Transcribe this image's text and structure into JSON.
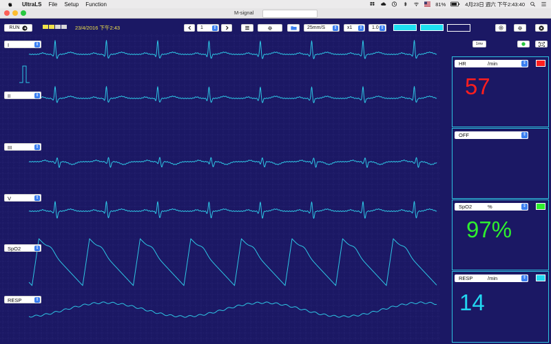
{
  "menubar": {
    "app_name": "UltraLS",
    "menus": [
      "File",
      "Setup",
      "Function"
    ],
    "battery": "81%",
    "datetime": "4月23日 週六 下午2:43:40"
  },
  "window": {
    "title": "M-signal"
  },
  "toolbar": {
    "run_label": "RUN",
    "date_time": "23/4/2016 下午2:43",
    "page_value": "1",
    "speed": "25mm/S",
    "gain": "x1",
    "scale": "1.0",
    "cal_label": "1mv"
  },
  "channels": [
    {
      "label": "I"
    },
    {
      "label": "II"
    },
    {
      "label": "III"
    },
    {
      "label": "V"
    },
    {
      "label": "SpO2"
    },
    {
      "label": "RESP"
    }
  ],
  "panels": {
    "hr": {
      "label": "HR",
      "unit": "/min",
      "value": "57",
      "color": "#ff1e1e"
    },
    "off": {
      "label": "OFF"
    },
    "spo2": {
      "label": "SpO2",
      "unit": "%",
      "value": "97%",
      "color": "#2ef02e"
    },
    "resp": {
      "label": "RESP",
      "unit": "/min",
      "value": "14",
      "color": "#22d6f0"
    }
  },
  "colors": {
    "background": "#1b1864",
    "grid": "#3a3588",
    "trace": "#2ec8e6"
  }
}
